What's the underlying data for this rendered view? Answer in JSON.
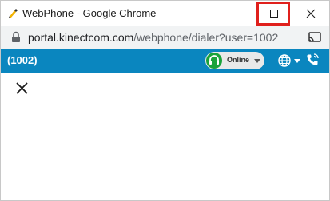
{
  "window": {
    "title": "WebPhone - Google Chrome"
  },
  "address_bar": {
    "host": "portal.kinectcom.com",
    "path": "/webphone/dialer?user=1002"
  },
  "app_header": {
    "user_label": "(1002)",
    "status_label": "Online",
    "status_color": "#1aa33a",
    "accent_color": "#0a86bf"
  },
  "icons": {
    "app": "webphone-icon",
    "lock": "lock-icon",
    "cast": "cast-icon",
    "headset": "headset-icon",
    "globe": "globe-icon",
    "phone": "phone-icon",
    "close": "close-icon"
  }
}
